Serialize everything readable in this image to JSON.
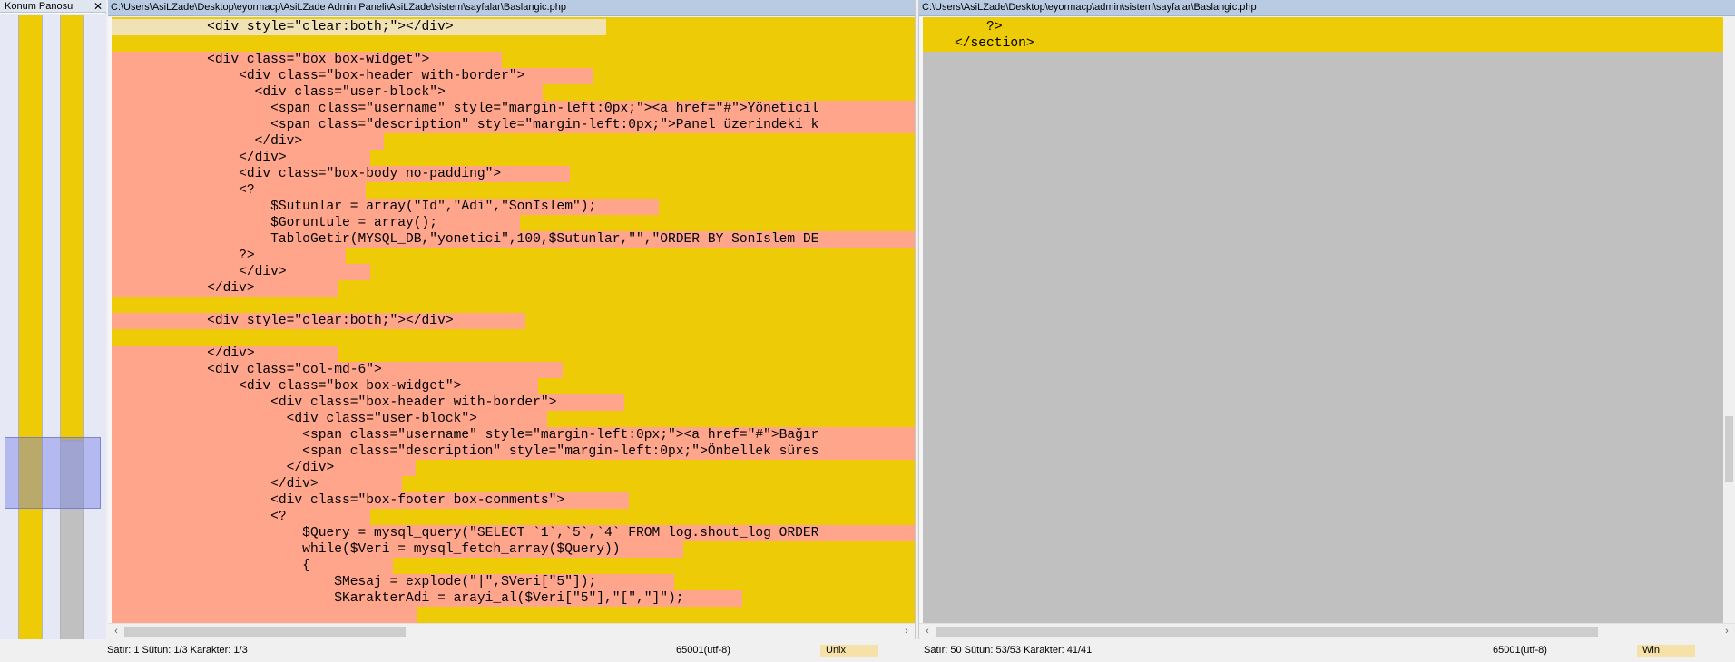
{
  "location_panel": {
    "title": "Konum Panosu",
    "close_glyph": "✕"
  },
  "left_pane": {
    "path": "C:\\Users\\AsiLZade\\Desktop\\eyormacp\\AsiLZade Admin Paneli\\AsiLZade\\sistem\\sayfalar\\Baslangic.php",
    "lines": [
      "            <div style=\"clear:both;\"></div>",
      "",
      "            <div class=\"box box-widget\">",
      "                <div class=\"box-header with-border\">",
      "                  <div class=\"user-block\">",
      "                    <span class=\"username\" style=\"margin-left:0px;\"><a href=\"#\">Yöneticil",
      "                    <span class=\"description\" style=\"margin-left:0px;\">Panel üzerindeki k",
      "                  </div>",
      "                </div>",
      "                <div class=\"box-body no-padding\">",
      "                <?",
      "                    $Sutunlar = array(\"Id\",\"Adi\",\"SonIslem\");",
      "                    $Goruntule = array();",
      "                    TabloGetir(MYSQL_DB,\"yonetici\",100,$Sutunlar,\"\",\"ORDER BY SonIslem DE",
      "                ?>",
      "                </div>",
      "            </div>",
      "",
      "            <div style=\"clear:both;\"></div>",
      "",
      "            </div>",
      "            <div class=\"col-md-6\">",
      "                <div class=\"box box-widget\">",
      "                    <div class=\"box-header with-border\">",
      "                      <div class=\"user-block\">",
      "                        <span class=\"username\" style=\"margin-left:0px;\"><a href=\"#\">Bağır",
      "                        <span class=\"description\" style=\"margin-left:0px;\">Önbellek süres",
      "                      </div>",
      "                    </div>",
      "                    <div class=\"box-footer box-comments\">",
      "                    <?",
      "                        $Query = mysql_query(\"SELECT `1`,`5`,`4` FROM log.shout_log ORDER",
      "                        while($Veri = mysql_fetch_array($Query))",
      "                        {",
      "                            $Mesaj = explode(\"|\",$Veri[\"5\"]);",
      "                            $KarakterAdi = arayi_al($Veri[\"5\"],\"[\",\"]\");",
      ""
    ]
  },
  "right_pane": {
    "path": "C:\\Users\\AsiLZade\\Desktop\\eyormacp\\admin\\sistem\\sayfalar\\Baslangic.php",
    "lines": [
      "        ?>",
      "    </section>"
    ]
  },
  "status_left": {
    "position": "Satır: 1  Sütun: 1/3  Karakter: 1/3",
    "encoding": "65001(utf-8)",
    "eol": "Unix"
  },
  "status_right": {
    "position": "Satır: 50  Sütun: 53/53  Karakter: 41/41",
    "encoding": "65001(utf-8)",
    "eol": "Win"
  },
  "colors": {
    "changed": "#eecb07",
    "removed": "#ffa58b",
    "empty": "#c0c0c0"
  }
}
